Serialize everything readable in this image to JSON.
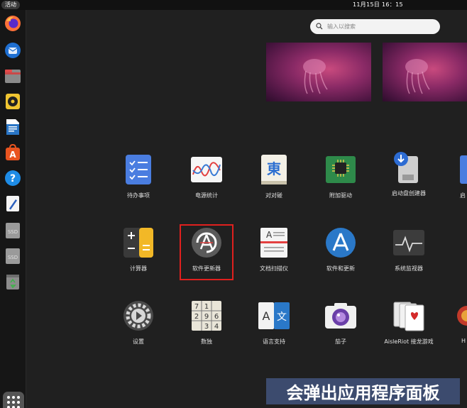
{
  "topbar": {
    "activities": "活动",
    "clock": "11月15日  16：15"
  },
  "search": {
    "placeholder": "输入以搜索"
  },
  "dock": {
    "items": [
      "firefox-icon",
      "thunderbird-icon",
      "files-icon",
      "rhythmbox-icon",
      "writer-icon",
      "app-center-icon",
      "help-icon",
      "text-editor-icon",
      "ssd-drive-icon",
      "ssd-drive-icon",
      "trash-icon"
    ],
    "ssd_label": "SSD"
  },
  "apps": [
    {
      "label": "待办事项",
      "icon": "todo-icon"
    },
    {
      "label": "电源统计",
      "icon": "power-statistics-icon"
    },
    {
      "label": "对对碰",
      "icon": "mahjongg-icon",
      "glyph": "東"
    },
    {
      "label": "附加驱动",
      "icon": "additional-drivers-icon"
    },
    {
      "label": "启动盘创建器",
      "icon": "startup-disk-creator-icon"
    },
    {
      "label": "启",
      "icon": "partial-app-icon"
    },
    {
      "label": "计算器",
      "icon": "calculator-icon"
    },
    {
      "label": "软件更新器",
      "icon": "software-updater-icon"
    },
    {
      "label": "文档扫描仪",
      "icon": "document-scanner-icon"
    },
    {
      "label": "软件和更新",
      "icon": "software-and-updates-icon"
    },
    {
      "label": "系统监视器",
      "icon": "system-monitor-icon"
    },
    {
      "label": "设置",
      "icon": "settings-icon"
    },
    {
      "label": "数独",
      "icon": "sudoku-icon",
      "digits": [
        "7",
        "1",
        "",
        "2",
        "9",
        "6",
        "",
        "3",
        "4"
      ]
    },
    {
      "label": "语言支持",
      "icon": "language-support-icon",
      "glyph_a": "A",
      "glyph_b": "文"
    },
    {
      "label": "茄子",
      "icon": "cheese-icon"
    },
    {
      "label": "AisleRiot 接龙游戏",
      "icon": "aisleriot-icon"
    },
    {
      "label": "H",
      "icon": "partial-app-icon"
    }
  ],
  "caption": "会弹出应用程序面板"
}
